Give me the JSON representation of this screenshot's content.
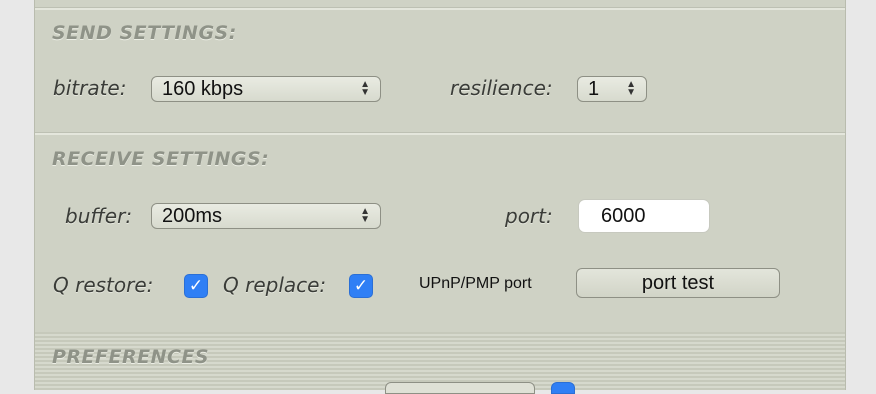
{
  "send": {
    "title": "SEND SETTINGS:",
    "bitrate_label": "bitrate:",
    "bitrate_value": "160 kbps",
    "resilience_label": "resilience:",
    "resilience_value": "1"
  },
  "receive": {
    "title": "RECEIVE SETTINGS:",
    "buffer_label": "buffer:",
    "buffer_value": "200ms",
    "port_label": "port:",
    "port_value": "6000",
    "q_restore_label": "Q restore:",
    "q_restore_checked": true,
    "q_replace_label": "Q replace:",
    "q_replace_checked": true,
    "upnp_label": "UPnP/PMP port",
    "port_test_label": "port test"
  },
  "preferences": {
    "title": "PREFERENCES"
  },
  "colors": {
    "panel": "#cfd2c5",
    "checkbox": "#2f7ff5"
  },
  "icons": {
    "select_arrows": "updown-chevron-icon",
    "checkmark": "checkmark-icon"
  }
}
